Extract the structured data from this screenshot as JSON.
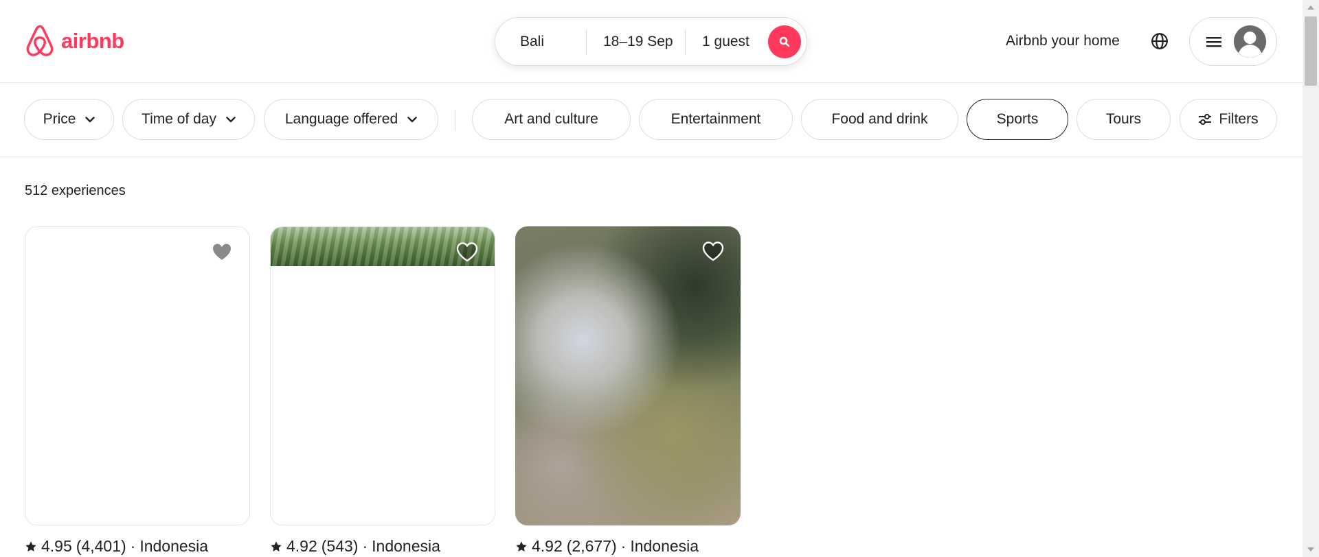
{
  "brand": {
    "name": "airbnb",
    "color": "#ff385c",
    "icon": "airbnb-logo-icon"
  },
  "search": {
    "location": "Bali",
    "dates": "18–19 Sep",
    "guests": "1 guest",
    "icon": "search-icon"
  },
  "header": {
    "host_link": "Airbnb your home",
    "globe_icon": "globe-icon",
    "menu_icon": "hamburger-icon",
    "avatar_icon": "user-avatar-icon"
  },
  "filters": {
    "dropdowns": [
      {
        "label": "Price",
        "icon": "chevron-down-icon"
      },
      {
        "label": "Time of day",
        "icon": "chevron-down-icon"
      },
      {
        "label": "Language offered",
        "icon": "chevron-down-icon"
      }
    ],
    "categories": [
      {
        "label": "Art and culture",
        "selected": false
      },
      {
        "label": "Entertainment",
        "selected": false
      },
      {
        "label": "Food and drink",
        "selected": false
      },
      {
        "label": "Sports",
        "selected": true
      },
      {
        "label": "Tours",
        "selected": false
      }
    ],
    "filters_button": {
      "label": "Filters",
      "icon": "sliders-icon"
    }
  },
  "results": {
    "count_text": "512 experiences",
    "cards": [
      {
        "rating": "4.95",
        "reviews": "(4,401)",
        "separator": "·",
        "location": "Indonesia",
        "favorite_icon": "heart-icon"
      },
      {
        "rating": "4.92",
        "reviews": "(543)",
        "separator": "·",
        "location": "Indonesia",
        "favorite_icon": "heart-icon"
      },
      {
        "rating": "4.92",
        "reviews": "(2,677)",
        "separator": "·",
        "location": "Indonesia",
        "favorite_icon": "heart-icon"
      }
    ]
  }
}
